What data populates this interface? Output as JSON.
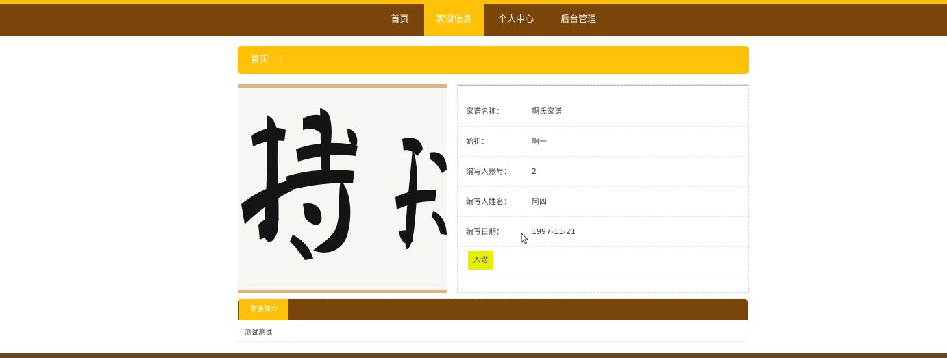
{
  "nav": {
    "items": [
      {
        "label": "首页",
        "active": false
      },
      {
        "label": "家谱信息",
        "active": true
      },
      {
        "label": "个人中心",
        "active": false
      },
      {
        "label": "后台管理",
        "active": false
      }
    ]
  },
  "breadcrumb": {
    "home": "首页",
    "separator": "/"
  },
  "detail": {
    "rows": [
      {
        "label": "家谱名称：",
        "value": "啊氏家谱"
      },
      {
        "label": "始祖：",
        "value": "啊一"
      },
      {
        "label": "编写人账号：",
        "value": "2"
      },
      {
        "label": "编写人姓名：",
        "value": "阿四"
      },
      {
        "label": "编写日期：",
        "value": "1997-11-21"
      }
    ],
    "join_label": "入谱"
  },
  "intro": {
    "tab_label": "家族简介",
    "text": "测试测试"
  },
  "colors": {
    "accent": "#ffc107",
    "brown": "#7a4508",
    "join_button": "#e6f000"
  }
}
